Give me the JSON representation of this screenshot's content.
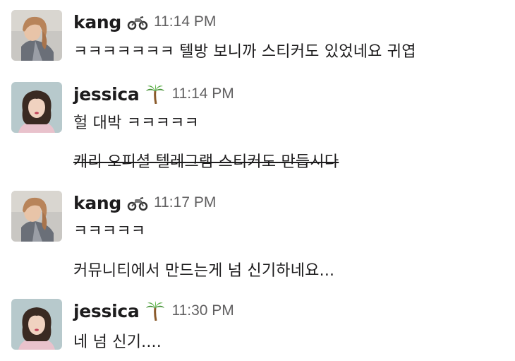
{
  "messages": [
    {
      "author": "kang",
      "author_emoji": "motorcycle-icon",
      "time": "11:14 PM",
      "lines": [
        "ㅋㅋㅋㅋㅋㅋㅋ 텔방 보니까 스티커도 있었네요 귀엽"
      ]
    },
    {
      "author": "jessica",
      "author_emoji": "palm-tree-icon",
      "time": "11:14 PM",
      "lines": [
        "헐 대박 ㅋㅋㅋㅋㅋ",
        "캐리 오피셜 텔레그램 스티커도 만듭시다"
      ],
      "struck_lines": [
        1
      ]
    },
    {
      "author": "kang",
      "author_emoji": "motorcycle-icon",
      "time": "11:17 PM",
      "lines": [
        "ㅋㅋㅋㅋㅋ",
        "커뮤니티에서 만드는게 넘 신기하네요..."
      ]
    },
    {
      "author": "jessica",
      "author_emoji": "palm-tree-icon",
      "time": "11:30 PM",
      "lines": [
        "네 넘 신기...."
      ]
    }
  ]
}
